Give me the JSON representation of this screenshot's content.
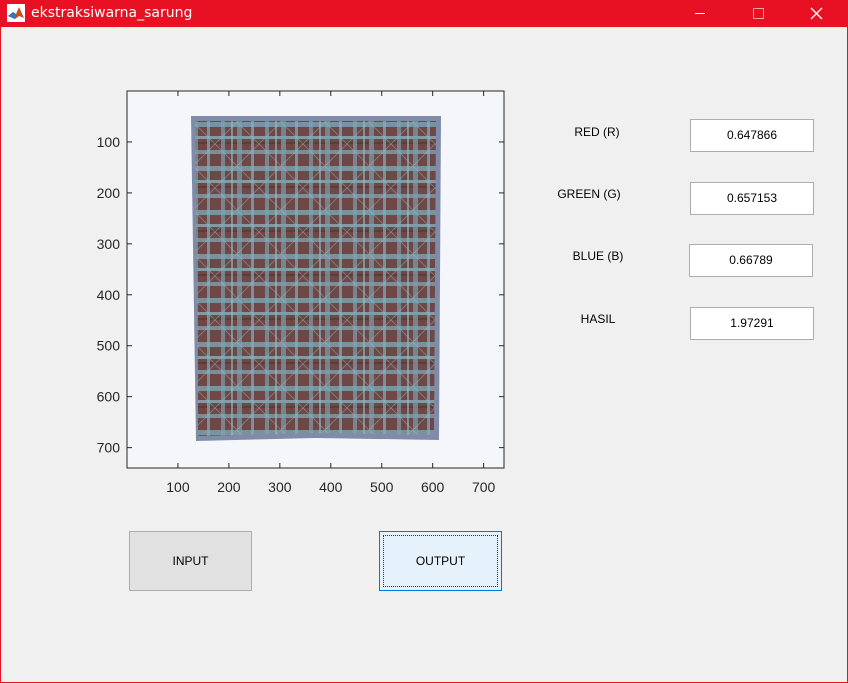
{
  "window": {
    "title": "ekstraksiwarna_sarung",
    "controls": {
      "minimize_icon": "minimize-icon",
      "maximize_icon": "maximize-icon",
      "close_icon": "close-icon"
    },
    "accent_color": "#e81123"
  },
  "image_axes": {
    "xticks": [
      "100",
      "200",
      "300",
      "400",
      "500",
      "600",
      "700"
    ],
    "yticks": [
      "100",
      "200",
      "300",
      "400",
      "500",
      "600",
      "700"
    ],
    "image_description_colors": {
      "plaid_base": "#6e4a47",
      "plaid_stripe": "#7fa8b8",
      "background": "#f4f6fa",
      "border": "#7f8ba8"
    }
  },
  "fields": [
    {
      "label": "RED (R)",
      "value": "0.647866"
    },
    {
      "label": "GREEN (G)",
      "value": "0.657153"
    },
    {
      "label": "BLUE (B)",
      "value": "0.66789"
    },
    {
      "label": "HASIL",
      "value": "1.97291"
    }
  ],
  "buttons": {
    "input_label": "INPUT",
    "output_label": "OUTPUT"
  }
}
